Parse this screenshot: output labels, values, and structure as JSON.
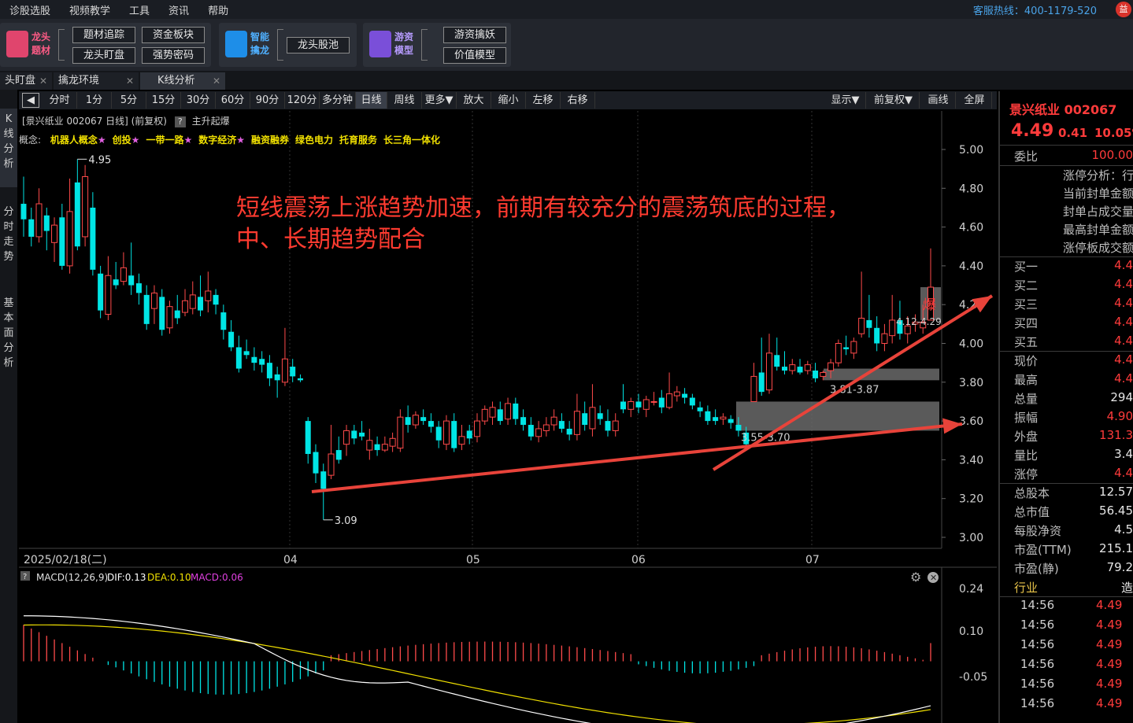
{
  "menu": [
    "诊股选股",
    "视频教学",
    "工具",
    "资讯",
    "帮助"
  ],
  "hotline": "客服热线：400-1179-520",
  "logo_char": "益",
  "toolbar": {
    "group1": {
      "name1": "龙头",
      "name2": "题材",
      "buttons": [
        "题材追踪",
        "资金板块",
        "龙头盯盘",
        "强势密码"
      ]
    },
    "group2": {
      "name1": "智能",
      "name2": "擒龙",
      "buttons": [
        "龙头股池"
      ]
    },
    "group3": {
      "name1": "游资",
      "name2": "模型",
      "buttons": [
        "游资擒妖",
        "价值模型"
      ]
    }
  },
  "tabs": [
    "头盯盘",
    "擒龙环境",
    "K线分析"
  ],
  "leftnav": [
    "K线分析",
    "分时走势",
    "基本面分析"
  ],
  "ktool": {
    "periods": [
      "分时",
      "1分",
      "5分",
      "15分",
      "30分",
      "60分",
      "90分",
      "120分",
      "多分钟",
      "日线",
      "周线",
      "更多▼",
      "放大",
      "缩小",
      "左移",
      "右移"
    ],
    "right": [
      "显示▼",
      "前复权▼",
      "画线",
      "全屏"
    ]
  },
  "chart": {
    "header": "[景兴纸业 002067 日线] (前复权)",
    "help": "?",
    "pattern": "主升起爆",
    "concept_label": "概念:",
    "concepts": [
      "机器人概念★",
      "创投★",
      "一带一路★",
      "数字经济★",
      "融资融券",
      "绿色电力",
      "托育服务",
      "长三角一体化"
    ],
    "annotation_line1": "短线震荡上涨趋势加速，前期有较充分的震荡筑底的过程，",
    "annotation_line2": "中、长期趋势配合",
    "price_axis": [
      "5.00",
      "4.80",
      "4.60",
      "4.40",
      "4.20",
      "4.00",
      "3.80",
      "3.60",
      "3.40",
      "3.20",
      "3.00"
    ],
    "date_axis": {
      "start": "2025/02/18(二)",
      "months": [
        "04",
        "05",
        "06",
        "07"
      ]
    },
    "high_label": "4.95",
    "low_label": "3.09",
    "zone_labels": [
      "3.81-3.87",
      "3.55-3.70",
      "4.12-4.29"
    ],
    "bao": "爆",
    "macd_header": {
      "name": "MACD(12,26,9)",
      "dif": "DIF:0.13",
      "dea": "DEA:0.10",
      "macd": "MACD:0.06"
    },
    "macd_axis": [
      "0.24",
      "0.10",
      "-0.05"
    ],
    "colors": {
      "up": "#ff4a4a",
      "down": "#00e5e5",
      "dif": "#ffffff",
      "dea": "#f0e000",
      "arrow": "#e8433a"
    }
  },
  "chart_data": {
    "type": "candlestick",
    "title": "景兴纸业 002067 日线",
    "ylim": [
      3.0,
      5.0
    ],
    "x_months": [
      "2025/02/18",
      "04",
      "05",
      "06",
      "07"
    ],
    "high": 4.95,
    "low": 3.09,
    "last": 4.49,
    "macd": {
      "dif": 0.13,
      "dea": 0.1,
      "macd": 0.06
    }
  },
  "quote": {
    "name": "景兴纸业 002067",
    "price": "4.49",
    "change": "0.41",
    "pct": "10.05%",
    "weibi_label": "委比",
    "weibi": "100.00",
    "limit_lines": [
      "涨停分析：行",
      "当前封单金额",
      "封单占成交量",
      "最高封单金额",
      "涨停板成交额"
    ],
    "book": [
      {
        "k": "买一",
        "v": "4.4"
      },
      {
        "k": "买二",
        "v": "4.4"
      },
      {
        "k": "买三",
        "v": "4.4"
      },
      {
        "k": "买四",
        "v": "4.4"
      },
      {
        "k": "买五",
        "v": "4.4"
      }
    ],
    "stats": [
      {
        "k": "现价",
        "v": "4.4",
        "c": "red"
      },
      {
        "k": "最高",
        "v": "4.4",
        "c": "red"
      },
      {
        "k": "总量",
        "v": "294",
        "c": "white"
      },
      {
        "k": "振幅",
        "v": "4.90",
        "c": "red"
      },
      {
        "k": "外盘",
        "v": "131.3",
        "c": "red"
      },
      {
        "k": "量比",
        "v": "3.4",
        "c": "white"
      },
      {
        "k": "涨停",
        "v": "4.4",
        "c": "red"
      }
    ],
    "fund": [
      {
        "k": "总股本",
        "v": "12.57"
      },
      {
        "k": "总市值",
        "v": "56.45"
      },
      {
        "k": "每股净资",
        "v": "4.5"
      },
      {
        "k": "市盈(TTM)",
        "v": "215.1"
      },
      {
        "k": "市盈(静)",
        "v": "79.2"
      }
    ],
    "industry_label": "行业",
    "industry_val": "造",
    "ticks": [
      {
        "t": "14:56",
        "p": "4.49"
      },
      {
        "t": "14:56",
        "p": "4.49"
      },
      {
        "t": "14:56",
        "p": "4.49"
      },
      {
        "t": "14:56",
        "p": "4.49"
      },
      {
        "t": "14:56",
        "p": "4.49"
      },
      {
        "t": "14:56",
        "p": "4.49"
      }
    ]
  }
}
